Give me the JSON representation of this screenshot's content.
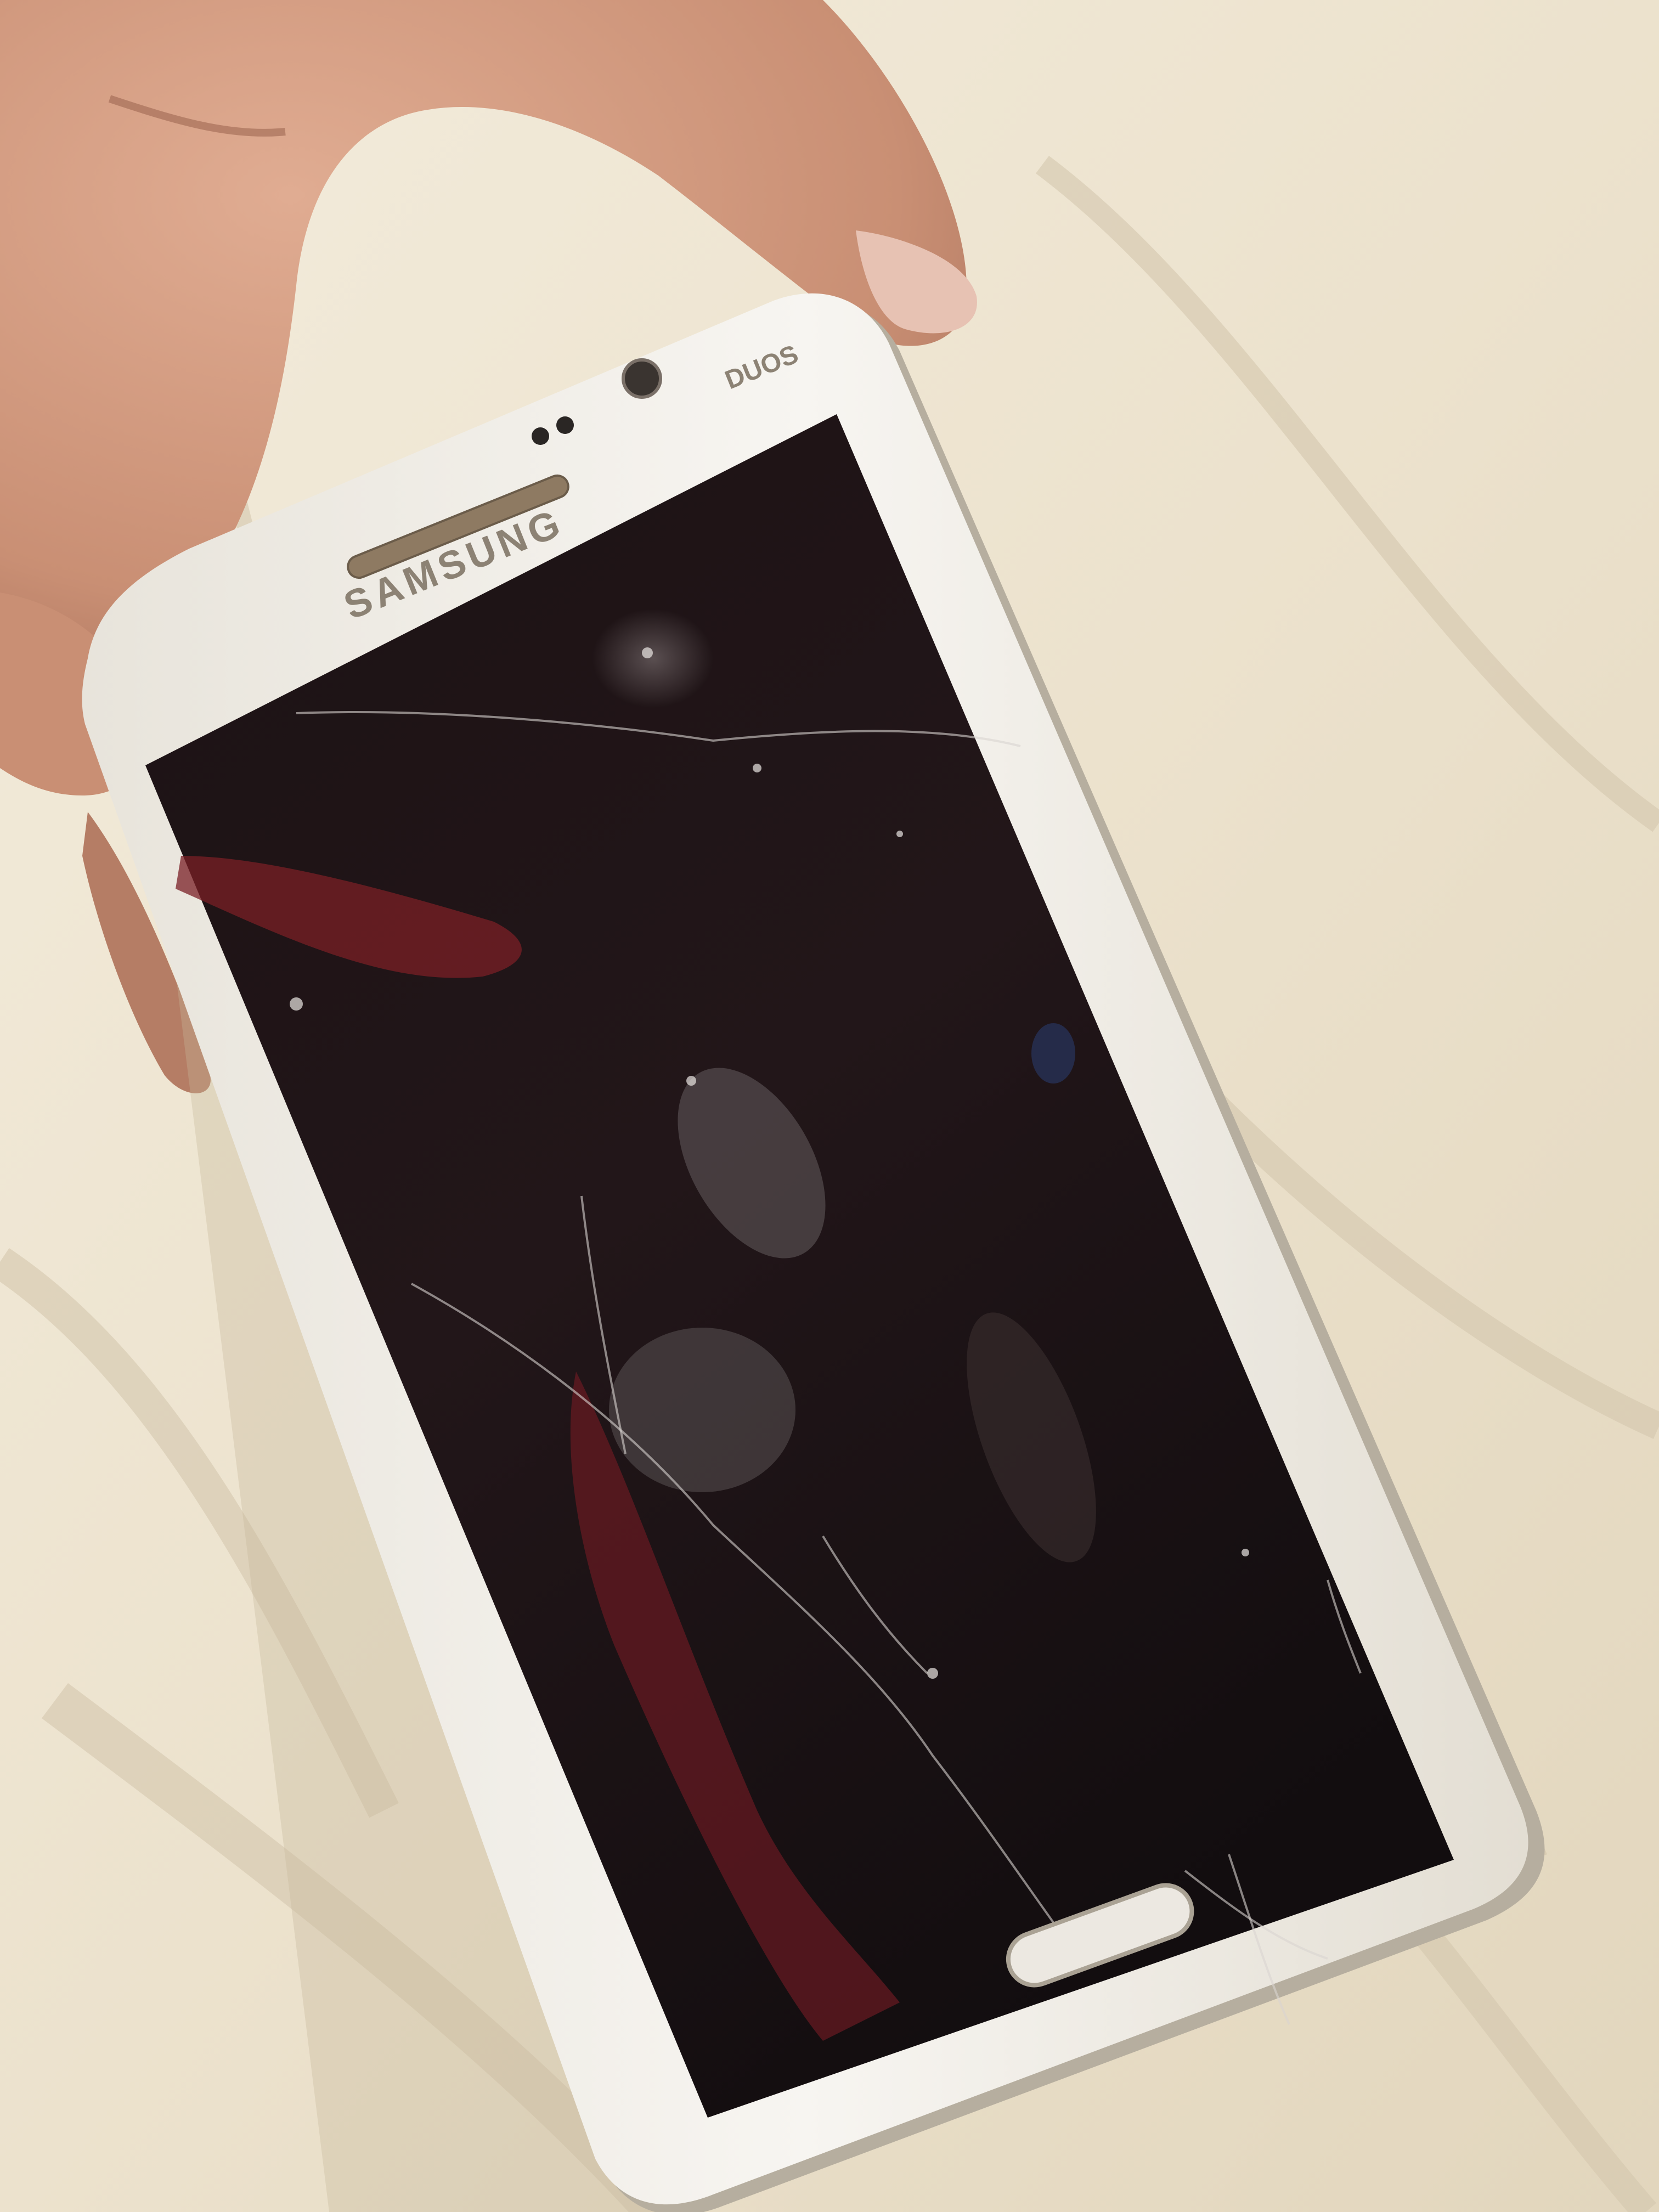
{
  "photo": {
    "brand_logo": "SAMSUNG",
    "duos_mark": "DUOS"
  },
  "colors": {
    "bedsheet": "#efe6d3",
    "bedsheet_shadow": "#cdbfa6",
    "phone_body": "#f3f1ec",
    "phone_edge": "#b9b3a6",
    "screen": "#1a1416",
    "screen_red": "#7a1f26",
    "skin": "#d9a287",
    "skin_shadow": "#b27b63",
    "logo_text": "#8c8274"
  },
  "icons": [
    "earpiece-grille-icon",
    "front-camera-icon",
    "proximity-sensor-icon",
    "home-button-icon"
  ]
}
